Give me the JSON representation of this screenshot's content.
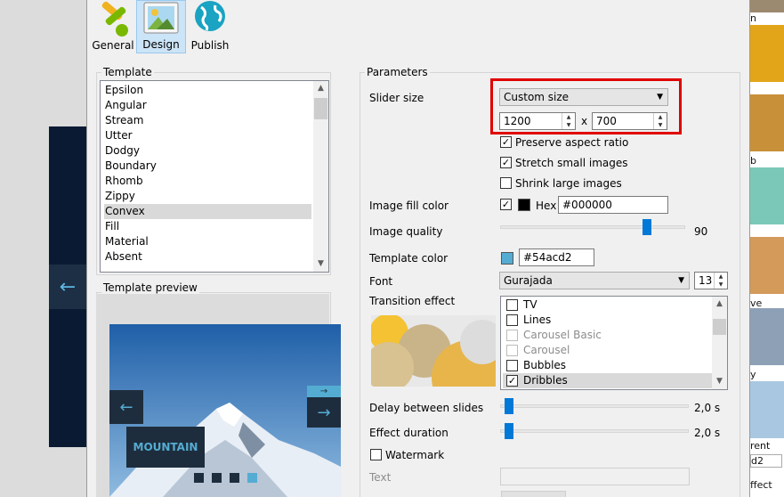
{
  "toolbar": {
    "general": "General",
    "design": "Design",
    "publish": "Publish"
  },
  "template_group": {
    "title": "Template",
    "items": [
      "Epsilon",
      "Angular",
      "Stream",
      "Utter",
      "Dodgy",
      "Boundary",
      "Rhomb",
      "Zippy",
      "Convex",
      "Fill",
      "Material",
      "Absent"
    ],
    "selected": "Convex"
  },
  "preview_group": {
    "title": "Template preview",
    "caption": "MOUNTAIN"
  },
  "parameters": {
    "title": "Parameters",
    "slider_size_label": "Slider size",
    "slider_size_value": "Custom size",
    "width": "1200",
    "height": "700",
    "x_sep": "x",
    "preserve_aspect": "Preserve aspect ratio",
    "stretch_small": "Stretch small images",
    "shrink_large": "Shrink large images",
    "image_fill_label": "Image fill color",
    "hex_label": "Hex",
    "hex_value": "#000000",
    "image_quality_label": "Image quality",
    "image_quality_value": "90",
    "template_color_label": "Template color",
    "template_color_value": "#54acd2",
    "font_label": "Font",
    "font_value": "Gurajada",
    "font_size": "13",
    "transition_label": "Transition effect",
    "transitions": [
      {
        "label": "TV",
        "checked": false,
        "disabled": false
      },
      {
        "label": "Lines",
        "checked": false,
        "disabled": false
      },
      {
        "label": "Carousel Basic",
        "checked": false,
        "disabled": true
      },
      {
        "label": "Carousel",
        "checked": false,
        "disabled": true
      },
      {
        "label": "Bubbles",
        "checked": false,
        "disabled": false
      },
      {
        "label": "Dribbles",
        "checked": true,
        "disabled": false
      }
    ],
    "delay_label": "Delay between slides",
    "delay_value": "2,0 s",
    "duration_label": "Effect duration",
    "duration_value": "2,0 s",
    "watermark_label": "Watermark",
    "text_label": "Text"
  },
  "background_right": {
    "labels": [
      "n",
      "b",
      "ve",
      "y",
      "rent",
      "d2",
      "ffect"
    ]
  },
  "colors": {
    "accent": "#0078d7",
    "template_color": "#54acd2",
    "highlight": "#e00000"
  }
}
